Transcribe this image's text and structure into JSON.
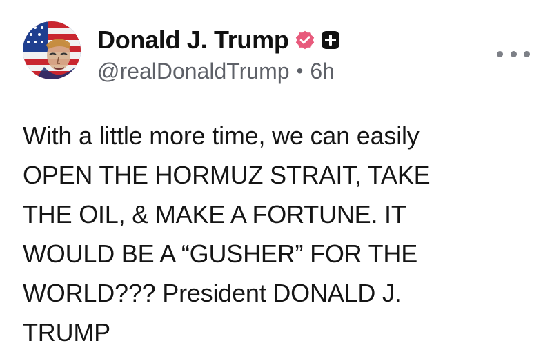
{
  "post": {
    "author": {
      "display_name": "Donald J. Trump",
      "handle": "@realDonaldTrump",
      "time_ago": "6h",
      "avatar_icon": "flag-portrait-avatar-icon",
      "verified_icon": "verified-badge-icon",
      "plus_icon": "plus-badge-icon"
    },
    "separator": "•",
    "more_icon": "more-options-icon",
    "body_lines": [
      "With a little more time, we can easily",
      "OPEN THE HORMUZ STRAIT, TAKE",
      "THE OIL, & MAKE A FORTUNE. IT",
      "WOULD BE A “GUSHER” FOR THE",
      "WORLD??? President DONALD J.",
      "TRUMP"
    ],
    "colors": {
      "badge_pink": "#e85a7c",
      "plus_badge": "#111111",
      "muted_text": "#5e6168"
    }
  }
}
